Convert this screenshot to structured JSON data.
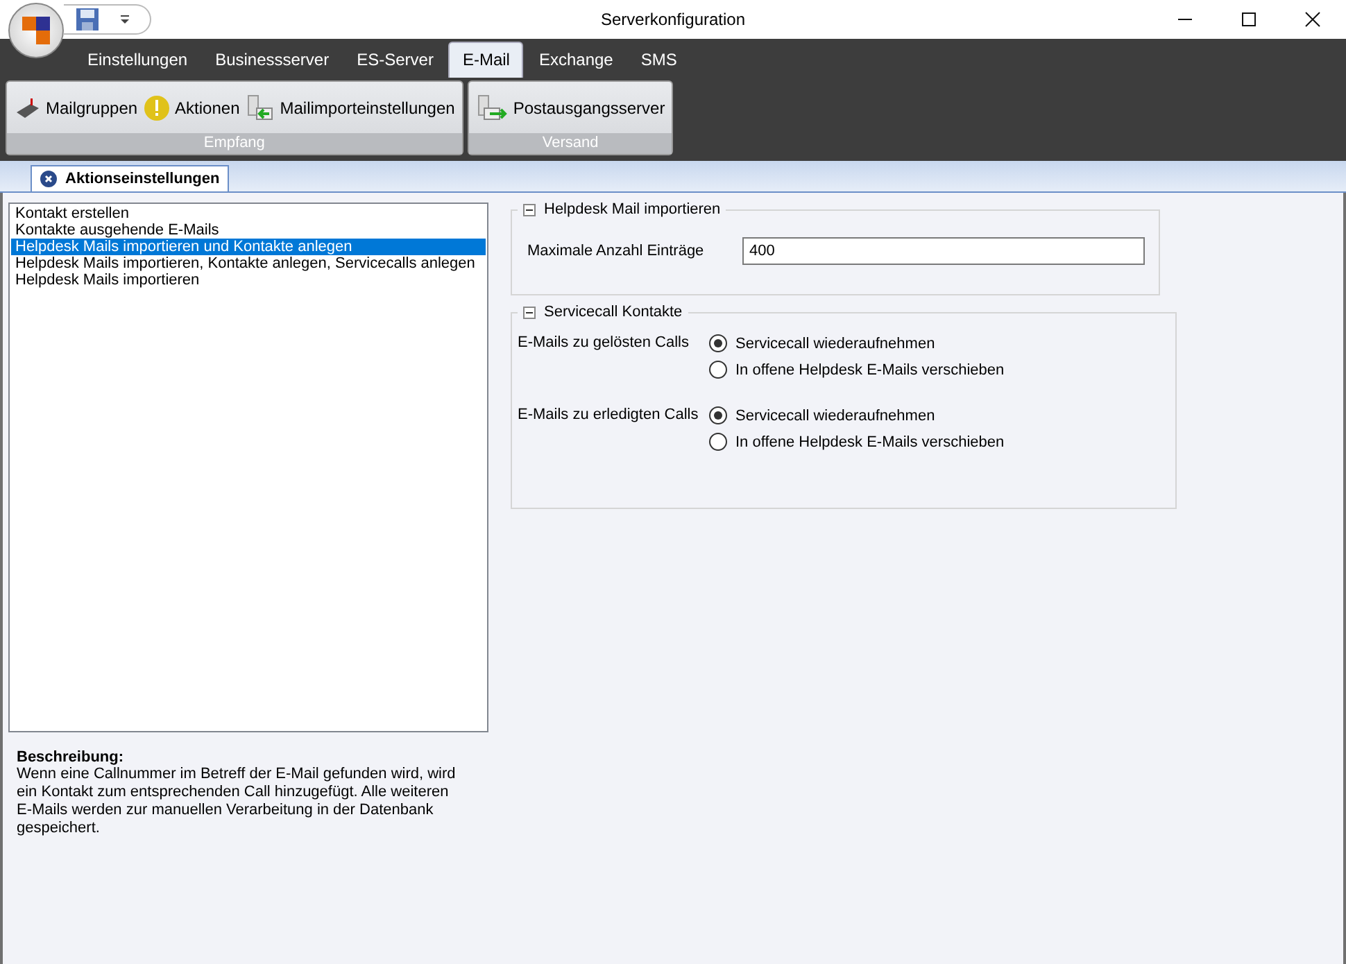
{
  "window": {
    "title": "Serverkonfiguration"
  },
  "ribbon_tabs": [
    {
      "label": "Einstellungen",
      "selected": false
    },
    {
      "label": "Businessserver",
      "selected": false
    },
    {
      "label": "ES-Server",
      "selected": false
    },
    {
      "label": "E-Mail",
      "selected": true
    },
    {
      "label": "Exchange",
      "selected": false
    },
    {
      "label": "SMS",
      "selected": false
    }
  ],
  "ribbon_groups": [
    {
      "label": "Empfang",
      "buttons": [
        {
          "label": "Mailgruppen",
          "kind": "mailbox"
        },
        {
          "label": "Aktionen",
          "kind": "warning"
        },
        {
          "label": "Mailimporteinstellungen",
          "kind": "import"
        }
      ]
    },
    {
      "label": "Versand",
      "buttons": [
        {
          "label": "Postausgangsserver",
          "kind": "export"
        }
      ]
    }
  ],
  "document_tab": {
    "label": "Aktionseinstellungen"
  },
  "actions": [
    {
      "label": "Kontakt erstellen",
      "selected": false
    },
    {
      "label": "Kontakte ausgehende E-Mails",
      "selected": false
    },
    {
      "label": "Helpdesk Mails importieren und Kontakte anlegen",
      "selected": true
    },
    {
      "label": "Helpdesk Mails importieren, Kontakte anlegen, Servicecalls anlegen",
      "selected": false
    },
    {
      "label": "Helpdesk Mails importieren",
      "selected": false
    }
  ],
  "description": {
    "title": "Beschreibung:",
    "text": "Wenn eine Callnummer im Betreff der E-Mail gefunden wird, wird ein Kontakt zum entsprechenden Call hinzugefügt. Alle weiteren E-Mails werden zur manuellen Verarbeitung in der Datenbank gespeichert."
  },
  "helpdesk_group": {
    "title": "Helpdesk Mail importieren",
    "expanded": true,
    "field_label": "Maximale Anzahl Einträge",
    "value": "400"
  },
  "servicecall_group": {
    "title": "Servicecall Kontakte",
    "expanded": true,
    "rows": [
      {
        "label": "E-Mails zu gelösten Calls",
        "options": [
          {
            "label": "Servicecall wiederaufnehmen",
            "selected": true
          },
          {
            "label": "In offene Helpdesk E-Mails verschieben",
            "selected": false
          }
        ]
      },
      {
        "label": "E-Mails zu erledigten Calls",
        "options": [
          {
            "label": "Servicecall wiederaufnehmen",
            "selected": true
          },
          {
            "label": "In offene Helpdesk E-Mails verschieben",
            "selected": false
          }
        ]
      }
    ]
  }
}
